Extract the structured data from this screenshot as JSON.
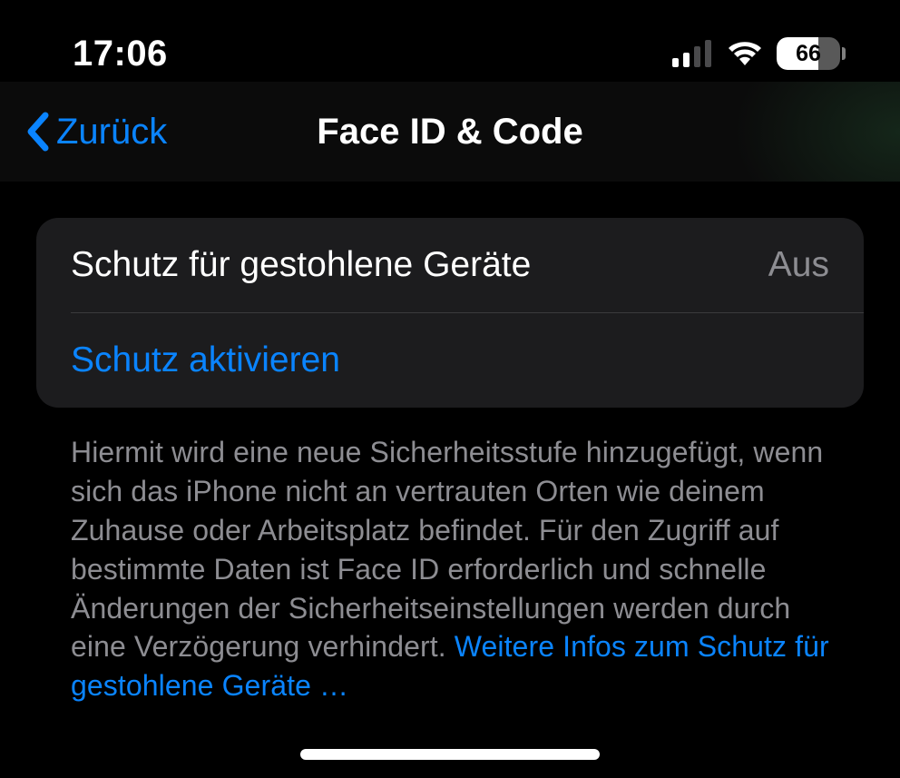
{
  "statusBar": {
    "time": "17:06",
    "batteryPercent": "66"
  },
  "nav": {
    "backLabel": "Zurück",
    "title": "Face ID & Code"
  },
  "settings": {
    "stolenDevice": {
      "label": "Schutz für gestohlene Geräte",
      "value": "Aus"
    },
    "activateLabel": "Schutz aktivieren"
  },
  "footer": {
    "description": "Hiermit wird eine neue Sicherheitsstufe hinzugefügt, wenn sich das iPhone nicht an vertrauten Orten wie deinem Zuhause oder Arbeitsplatz befindet. Für den Zugriff auf bestimmte Daten ist Face ID erforderlich und schnelle Änderungen der Sicherheitseinstellun­gen werden durch eine Verzögerung verhindert. ",
    "linkText": "Weitere Infos zum Schutz für gestohlene Geräte …"
  }
}
